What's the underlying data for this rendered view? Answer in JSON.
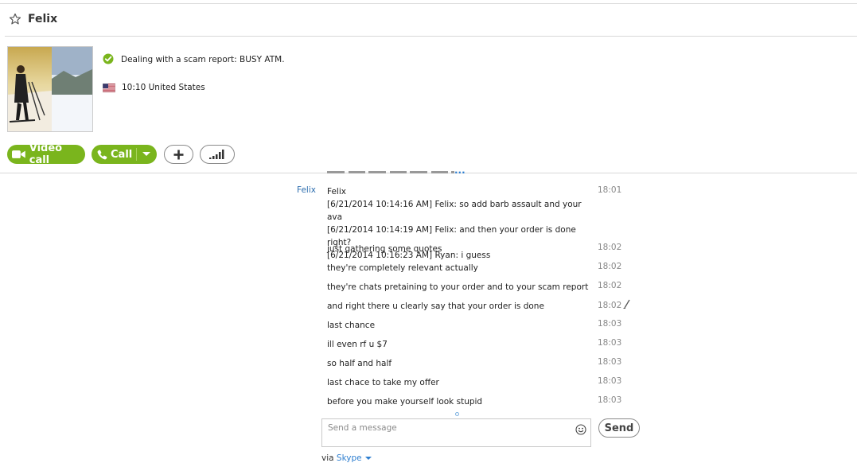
{
  "contact": {
    "name": "Felix",
    "mood": "Dealing with a scam report: BUSY ATM.",
    "local_time": "10:10",
    "country": "United States"
  },
  "actions": {
    "video_call_label": "Video call",
    "call_label": "Call"
  },
  "more_messages_indicator": "...",
  "conversation": {
    "sender": "Felix",
    "first_message": {
      "lines": [
        "Felix",
        "[6/21/2014 10:14:16 AM] Felix: so add barb assault and your ava",
        "[6/21/2014 10:14:19 AM] Felix: and then your order is done right?",
        "[6/21/2014 10:16:23 AM] Ryan: i guess"
      ],
      "time": "18:01"
    },
    "messages": [
      {
        "text": "just gathering some quotes",
        "time": "18:02"
      },
      {
        "text": "they're completely relevant actually",
        "time": "18:02"
      },
      {
        "text": "they're chats pretaining to your order and to your scam report",
        "time": "18:02"
      },
      {
        "text": "and right there u clearly say that your order is done",
        "time": "18:02"
      },
      {
        "text": "last chance",
        "time": "18:03"
      },
      {
        "text": "ill even rf u $7",
        "time": "18:03"
      },
      {
        "text": "so half and half",
        "time": "18:03"
      },
      {
        "text": "last chace to take my offer",
        "time": "18:03"
      },
      {
        "text": "before you make yourself look stupid",
        "time": "18:03"
      }
    ]
  },
  "composer": {
    "placeholder": "Send a message",
    "value": "",
    "send_label": "Send"
  },
  "footer": {
    "via_label": "via",
    "service_label": "Skype"
  },
  "colors": {
    "accent_green": "#7ab51d",
    "link_blue": "#2f7fd0",
    "sender_blue": "#2f6fb0"
  },
  "icons": {
    "favorite": "star-outline-icon",
    "presence": "online-status-icon",
    "country_flag": "us-flag-icon",
    "video": "video-camera-icon",
    "phone": "phone-icon",
    "add": "plus-icon",
    "call_quality": "signal-bars-icon",
    "emoticon": "smiley-icon",
    "edited": "pencil-icon"
  }
}
